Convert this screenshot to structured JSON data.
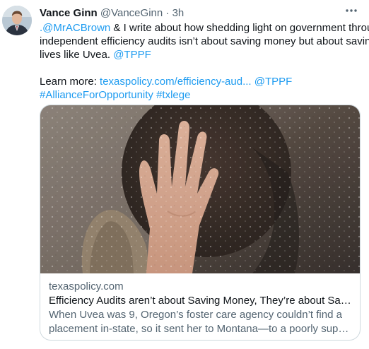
{
  "author": {
    "name": "Vance Ginn",
    "handle": "@VanceGinn",
    "separator": "·",
    "time": "3h"
  },
  "tweet": {
    "line1_mention": ".@MrACBrown",
    "line1_text": " & I write about how shedding light on government through",
    "line2_text": "independent efficiency audits isn’t about saving money but about saving",
    "line3_text": "lives like Uvea. ",
    "line3_mention": "@TPPF",
    "learn_more_label": "Learn more: ",
    "learn_more_url": "texaspolicy.com/efficiency-aud...",
    "learn_more_mention": "@TPPF",
    "hashtag1": "#AllianceForOpportunity",
    "hashtag2": "#txlege"
  },
  "card": {
    "image_icon": "rain-window-photo",
    "domain": "texaspolicy.com",
    "title": "Efficiency Audits aren’t about Saving Money, They’re about Saving Liv...",
    "description_line1": "When Uvea was 9, Oregon’s foster care agency couldn’t find a",
    "description_line2": "placement in-state, so it sent her to Montana—to a poorly supervised ..."
  },
  "icons": {
    "more": "more-horizontal-icon",
    "avatar": "avatar"
  },
  "colors": {
    "link": "#1d9bf0",
    "text": "#0f1419",
    "secondary": "#536471",
    "border": "#cfd9de"
  }
}
